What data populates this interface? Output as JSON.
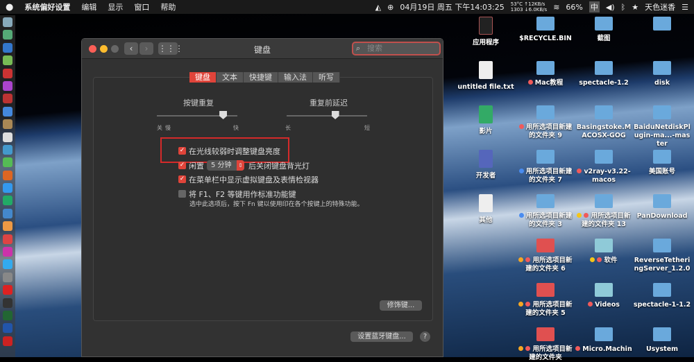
{
  "menubar": {
    "apple": "",
    "app": "系统偏好设置",
    "items": [
      "编辑",
      "显示",
      "窗口",
      "帮助"
    ],
    "status": {
      "datetime": "04月19日 周五 下午14:03:25",
      "temp": "53°C",
      "cpu": "1303",
      "net_up": "↑12KB/s",
      "net_down": "↓6.0KB/s",
      "battery": "66%",
      "input": "中",
      "user": "天色迷香"
    }
  },
  "window": {
    "title": "键盘",
    "search_placeholder": "搜索",
    "back": "‹",
    "forward": "›",
    "tabs": [
      "键盘",
      "文本",
      "快捷键",
      "输入法",
      "听写"
    ],
    "active_tab": 0,
    "key_repeat": {
      "label": "按键重复",
      "left1": "关",
      "left2": "慢",
      "right": "快",
      "value": 0.82
    },
    "delay": {
      "label": "重复前延迟",
      "left": "长",
      "right": "短",
      "value": 0.6
    },
    "options": [
      {
        "label": "在光线较弱时调整键盘亮度",
        "checked": true
      },
      {
        "label_pre": "闲置",
        "select": "5 分钟",
        "label_post": "后关闭键盘背光灯",
        "checked": true
      },
      {
        "label": "在菜单栏中显示虚拟键盘及表情检视器",
        "checked": true
      },
      {
        "label": "将 F1、F2 等键用作标准功能键",
        "checked": false,
        "note": "选中此选项后，按下 Fn 键以使用印在各个按键上的特殊功能。"
      }
    ],
    "modifier_btn": "修饰键...",
    "bluetooth_btn": "设置蓝牙键盘...",
    "help": "?",
    "check": "✓"
  },
  "desktop": [
    [
      "应用程序",
      "$RECYCLE.BIN",
      "截图",
      ""
    ],
    [
      "untitled file.txt",
      "Mac教程",
      "spectacle-1.2",
      "disk"
    ],
    [
      "影片",
      "用所选项目新建的文件夹 9",
      "Basingstoke.MACOSX-GOG",
      "BaiduNetdiskPlugin-ma...-master"
    ],
    [
      "开发者",
      "用所选项目新建的文件夹 7",
      "v2ray-v3.22-macos",
      "美国账号"
    ],
    [
      "其他",
      "用所选项目新建的文件夹 3",
      "用所选项目新建的文件夹 13",
      "PanDownload"
    ],
    [
      "",
      "用所选项目新建的文件夹 6",
      "软件",
      "ReverseTetheringServer_1.2.0"
    ],
    [
      "",
      "用所选项目新建的文件夹 5",
      "Videos",
      "spectacle-1-1.2"
    ],
    [
      "",
      "用所选项目新建的文件夹",
      "Micro.Machin",
      "Usystem"
    ]
  ]
}
